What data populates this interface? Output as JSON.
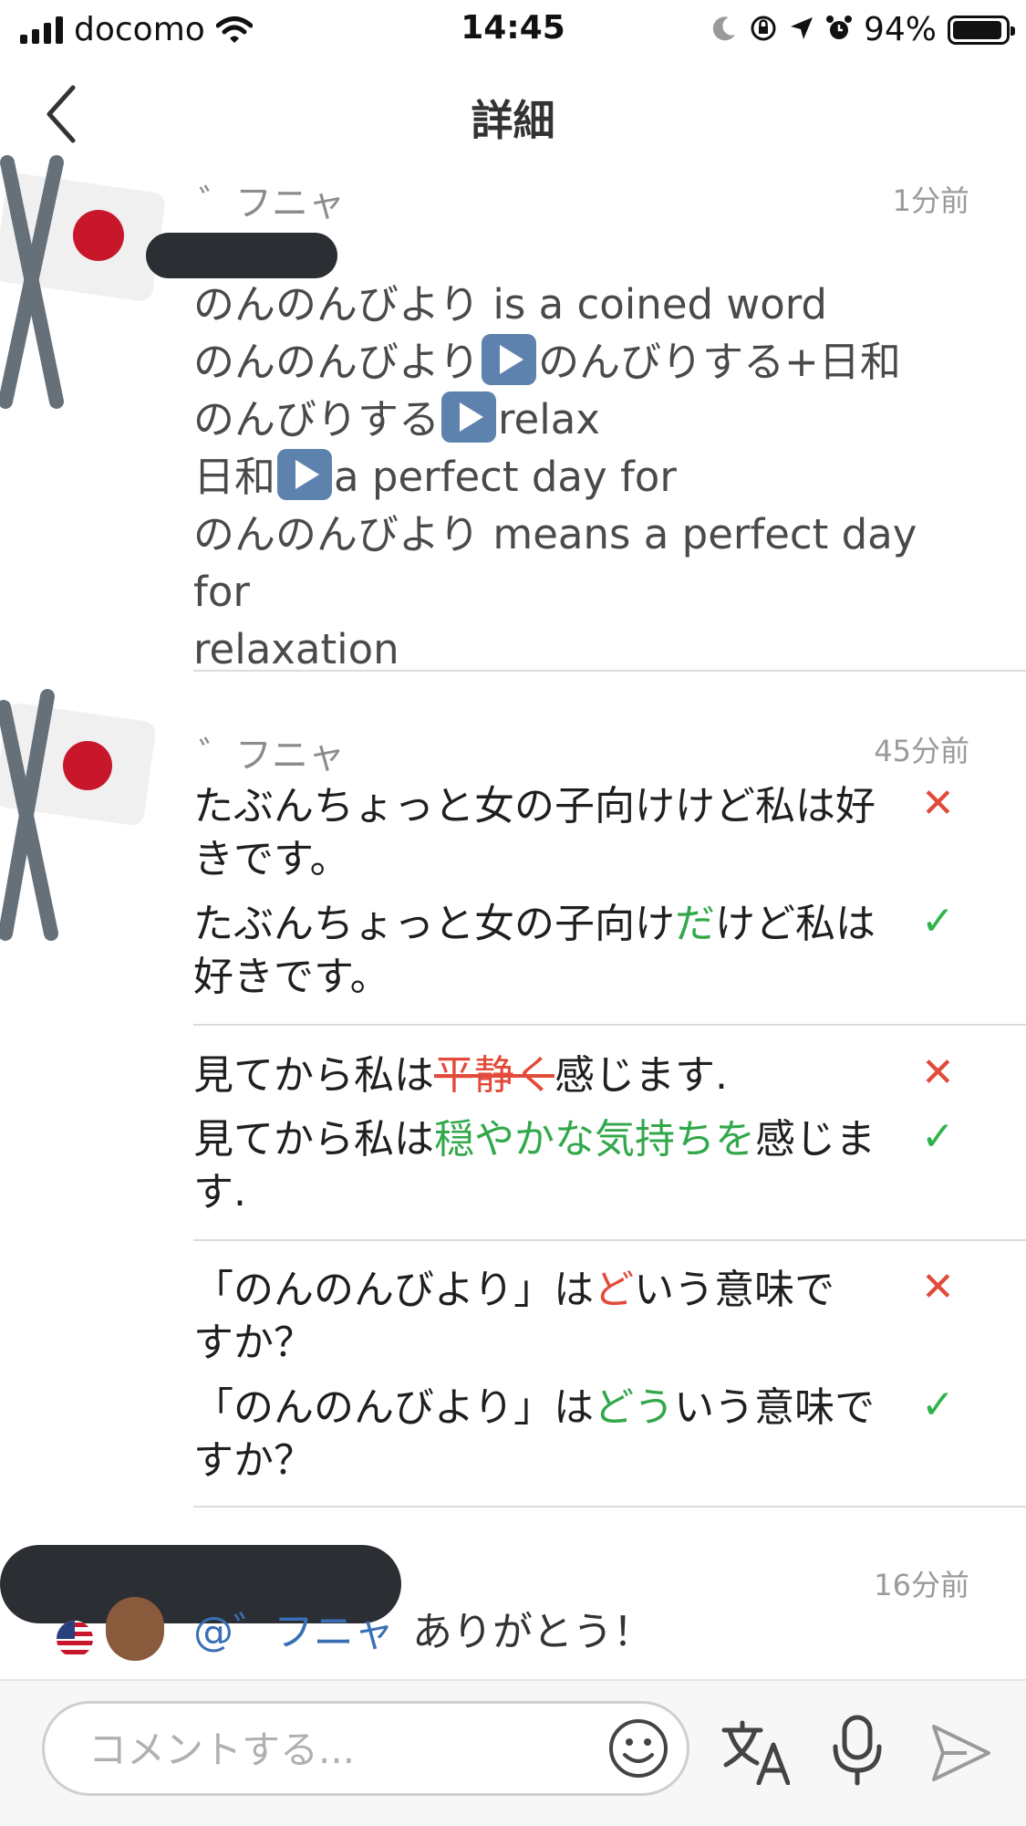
{
  "status_bar": {
    "carrier": "docomo",
    "time": "14:45",
    "battery": "94%",
    "battery_level": 0.94
  },
  "nav": {
    "title": "詳細"
  },
  "posts": [
    {
      "username": "゛フニャ",
      "time": "1分前",
      "lines": [
        "のんのんびより is a coined word",
        "のんのんびより",
        "のんびりする+日和",
        "のんびりする",
        "relax",
        "日和",
        "a perfect day for",
        "のんのんびより means a perfect day for",
        "relaxation"
      ]
    },
    {
      "username": "゛フニャ",
      "time": "45分前",
      "corrections": [
        {
          "wrong": "たぶんちょっと女の子向けけど私は好きです。",
          "right_a": "たぶんちょっと女の子向け",
          "right_hl": "だ",
          "right_b": "けど私は好きです。"
        },
        {
          "wrong_a": "見てから私は",
          "wrong_hl": "平静く",
          "wrong_b": "感じます.",
          "right_a": "見てから私は",
          "right_hl": "穏やかな気持ちを",
          "right_b": "感じます."
        },
        {
          "wrong_a": "「のんのんびより」は",
          "wrong_hl": "ど",
          "wrong_b": "いう意味ですか？",
          "right_a": "「のんのんびより」は",
          "right_hl": "どう",
          "right_b": "いう意味ですか？"
        }
      ]
    },
    {
      "time": "16分前",
      "mention": "@゛フニャ",
      "text": "ありがとう！"
    }
  ],
  "comment": {
    "placeholder": "コメントする..."
  },
  "icons": {
    "wrong": "✕",
    "correct": "✓"
  },
  "colors": {
    "wrong": "#e24a3a",
    "correct": "#2fb34a",
    "mention": "#3a6fb6"
  }
}
